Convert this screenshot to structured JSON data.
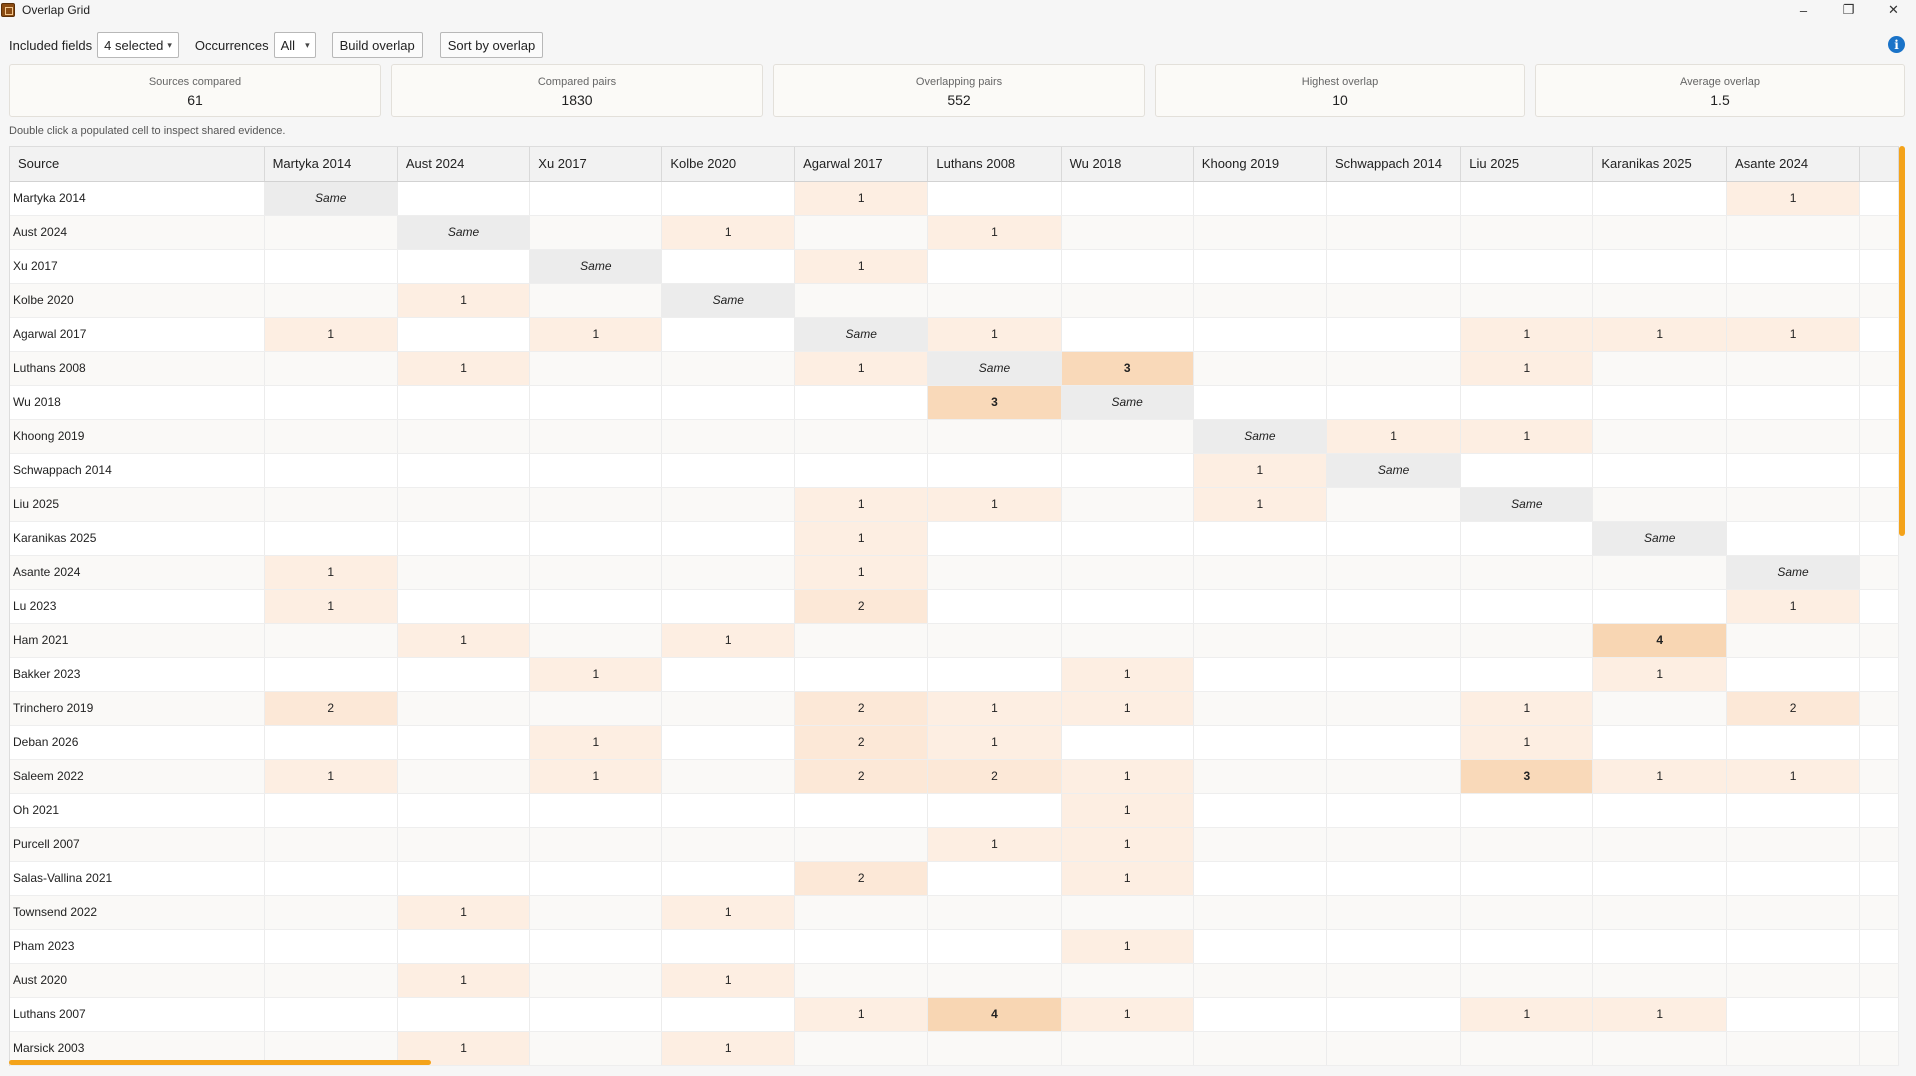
{
  "window": {
    "title": "Overlap Grid",
    "controls": [
      "–",
      "❐",
      "✕"
    ]
  },
  "toolbar": {
    "included_fields_label": "Included fields",
    "included_fields_value": "4 selected",
    "occurrences_label": "Occurrences",
    "occurrences_value": "All",
    "build_button": "Build overlap",
    "sort_button": "Sort by overlap",
    "info_glyph": "i"
  },
  "stats": [
    {
      "label": "Sources compared",
      "value": "61"
    },
    {
      "label": "Compared pairs",
      "value": "1830"
    },
    {
      "label": "Overlapping pairs",
      "value": "552"
    },
    {
      "label": "Highest overlap",
      "value": "10"
    },
    {
      "label": "Average overlap",
      "value": "1.5"
    }
  ],
  "hint": "Double click a populated cell to inspect shared evidence.",
  "grid": {
    "corner_label": "Source",
    "columns": [
      "Martyka 2014",
      "Aust 2024",
      "Xu 2017",
      "Kolbe 2020",
      "Agarwal 2017",
      "Luthans 2008",
      "Wu 2018",
      "Khoong 2019",
      "Schwappach 2014",
      "Liu 2025",
      "Karanikas 2025",
      "Asante 2024"
    ],
    "rows": [
      {
        "name": "Martyka 2014",
        "cells": [
          "Same",
          "",
          "",
          "",
          "1",
          "",
          "",
          "",
          "",
          "",
          "",
          "1"
        ]
      },
      {
        "name": "Aust 2024",
        "cells": [
          "",
          "Same",
          "",
          "1",
          "",
          "1",
          "",
          "",
          "",
          "",
          "",
          ""
        ]
      },
      {
        "name": "Xu 2017",
        "cells": [
          "",
          "",
          "Same",
          "",
          "1",
          "",
          "",
          "",
          "",
          "",
          "",
          ""
        ]
      },
      {
        "name": "Kolbe 2020",
        "cells": [
          "",
          "1",
          "",
          "Same",
          "",
          "",
          "",
          "",
          "",
          "",
          "",
          ""
        ]
      },
      {
        "name": "Agarwal 2017",
        "cells": [
          "1",
          "",
          "1",
          "",
          "Same",
          "1",
          "",
          "",
          "",
          "1",
          "1",
          "1"
        ]
      },
      {
        "name": "Luthans 2008",
        "cells": [
          "",
          "1",
          "",
          "",
          "1",
          "Same",
          "3",
          "",
          "",
          "1",
          "",
          ""
        ]
      },
      {
        "name": "Wu 2018",
        "cells": [
          "",
          "",
          "",
          "",
          "",
          "3",
          "Same",
          "",
          "",
          "",
          "",
          ""
        ]
      },
      {
        "name": "Khoong 2019",
        "cells": [
          "",
          "",
          "",
          "",
          "",
          "",
          "",
          "Same",
          "1",
          "1",
          "",
          ""
        ]
      },
      {
        "name": "Schwappach 2014",
        "cells": [
          "",
          "",
          "",
          "",
          "",
          "",
          "",
          "1",
          "Same",
          "",
          "",
          ""
        ]
      },
      {
        "name": "Liu 2025",
        "cells": [
          "",
          "",
          "",
          "",
          "1",
          "1",
          "",
          "1",
          "",
          "Same",
          "",
          ""
        ]
      },
      {
        "name": "Karanikas 2025",
        "cells": [
          "",
          "",
          "",
          "",
          "1",
          "",
          "",
          "",
          "",
          "",
          "Same",
          ""
        ]
      },
      {
        "name": "Asante 2024",
        "cells": [
          "1",
          "",
          "",
          "",
          "1",
          "",
          "",
          "",
          "",
          "",
          "",
          "Same"
        ]
      },
      {
        "name": "Lu 2023",
        "cells": [
          "1",
          "",
          "",
          "",
          "2",
          "",
          "",
          "",
          "",
          "",
          "",
          "1"
        ]
      },
      {
        "name": "Ham 2021",
        "cells": [
          "",
          "1",
          "",
          "1",
          "",
          "",
          "",
          "",
          "",
          "",
          "4",
          ""
        ]
      },
      {
        "name": "Bakker 2023",
        "cells": [
          "",
          "",
          "1",
          "",
          "",
          "",
          "1",
          "",
          "",
          "",
          "1",
          ""
        ]
      },
      {
        "name": "Trinchero 2019",
        "cells": [
          "2",
          "",
          "",
          "",
          "2",
          "1",
          "1",
          "",
          "",
          "1",
          "",
          "2"
        ]
      },
      {
        "name": "Deban 2026",
        "cells": [
          "",
          "",
          "1",
          "",
          "2",
          "1",
          "",
          "",
          "",
          "1",
          "",
          ""
        ]
      },
      {
        "name": "Saleem 2022",
        "cells": [
          "1",
          "",
          "1",
          "",
          "2",
          "2",
          "1",
          "",
          "",
          "3",
          "1",
          "1"
        ]
      },
      {
        "name": "Oh 2021",
        "cells": [
          "",
          "",
          "",
          "",
          "",
          "",
          "1",
          "",
          "",
          "",
          "",
          ""
        ]
      },
      {
        "name": "Purcell 2007",
        "cells": [
          "",
          "",
          "",
          "",
          "",
          "1",
          "1",
          "",
          "",
          "",
          "",
          ""
        ]
      },
      {
        "name": "Salas-Vallina 2021",
        "cells": [
          "",
          "",
          "",
          "",
          "2",
          "",
          "1",
          "",
          "",
          "",
          "",
          ""
        ]
      },
      {
        "name": "Townsend 2022",
        "cells": [
          "",
          "1",
          "",
          "1",
          "",
          "",
          "",
          "",
          "",
          "",
          "",
          ""
        ]
      },
      {
        "name": "Pham 2023",
        "cells": [
          "",
          "",
          "",
          "",
          "",
          "",
          "1",
          "",
          "",
          "",
          "",
          ""
        ]
      },
      {
        "name": "Aust 2020",
        "cells": [
          "",
          "1",
          "",
          "1",
          "",
          "",
          "",
          "",
          "",
          "",
          "",
          ""
        ]
      },
      {
        "name": "Luthans 2007",
        "cells": [
          "",
          "",
          "",
          "",
          "1",
          "4",
          "1",
          "",
          "",
          "1",
          "1",
          ""
        ]
      },
      {
        "name": "Marsick 2003",
        "cells": [
          "",
          "1",
          "",
          "1",
          "",
          "",
          "",
          "",
          "",
          "",
          "",
          ""
        ]
      }
    ]
  },
  "colors": {
    "accent_scroll": "#f4a31a",
    "info": "#1a73c8",
    "heat_low": "#fdeee2",
    "heat_high": "#f8d6b3",
    "same_cell": "#ececec"
  }
}
